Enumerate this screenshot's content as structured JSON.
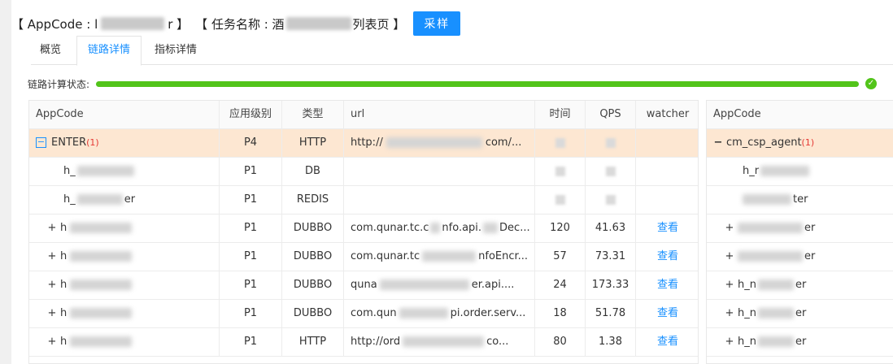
{
  "header": {
    "appcode_prefix": "【 AppCode : l",
    "appcode_suffix": "r 】",
    "task_prefix": "【 任务名称 : 酒",
    "task_suffix": "列表页 】",
    "sample_button": "采样"
  },
  "tabs": [
    {
      "label": "概览",
      "active": false
    },
    {
      "label": "链路详情",
      "active": true
    },
    {
      "label": "指标详情",
      "active": false
    }
  ],
  "status": {
    "label": "链路计算状态:",
    "progress": 1.0,
    "color": "#52c41a"
  },
  "main_table": {
    "headers": [
      "AppCode",
      "应用级别",
      "类型",
      "url",
      "时间",
      "QPS",
      "watcher"
    ],
    "rows": [
      {
        "toggle": "−",
        "app": "ENTER",
        "count": "(1)",
        "level": "P4",
        "type": "HTTP",
        "url": "http://",
        "url_tail": "com/...",
        "time": "",
        "qps": "",
        "watcher": ""
      },
      {
        "toggle": "",
        "app": "h_",
        "count": "",
        "level": "P1",
        "type": "DB",
        "url": "",
        "url_tail": "",
        "time": "",
        "qps": "",
        "watcher": ""
      },
      {
        "toggle": "",
        "app": "h_",
        "app_tail": "er",
        "count": "",
        "level": "P1",
        "type": "REDIS",
        "url": "",
        "url_tail": "",
        "time": "",
        "qps": "",
        "watcher": ""
      },
      {
        "toggle": "+",
        "app": "h",
        "count": "",
        "level": "P1",
        "type": "DUBBO",
        "url": "com.qunar.tc.c",
        "url_tail": "nfo.api.",
        "url_end": "Dec...",
        "time": "120",
        "qps": "41.63",
        "watcher": "查看"
      },
      {
        "toggle": "+",
        "app": "h",
        "count": "",
        "level": "P1",
        "type": "DUBBO",
        "url": "com.qunar.tc",
        "url_tail": "nfoEncr...",
        "time": "57",
        "qps": "73.31",
        "watcher": "查看"
      },
      {
        "toggle": "+",
        "app": "h",
        "count": "",
        "level": "P1",
        "type": "DUBBO",
        "url": "quna",
        "url_tail": "er.api....",
        "time": "24",
        "qps": "173.33",
        "watcher": "查看"
      },
      {
        "toggle": "+",
        "app": "h",
        "count": "",
        "level": "P1",
        "type": "DUBBO",
        "url": "com.qun",
        "url_tail": "pi.order.serv...",
        "time": "18",
        "qps": "51.78",
        "watcher": "查看"
      },
      {
        "toggle": "+",
        "app": "h",
        "count": "",
        "level": "P1",
        "type": "HTTP",
        "url": "http://ord",
        "url_tail": "co...",
        "time": "80",
        "qps": "1.38",
        "watcher": "查看"
      }
    ]
  },
  "side_table": {
    "header": "AppCode",
    "rows": [
      {
        "toggle": "−",
        "app": "cm_csp_agent",
        "count": "(1)"
      },
      {
        "toggle": "",
        "app": "h_r",
        "tail": ""
      },
      {
        "toggle": "",
        "app": "",
        "tail": "ter"
      },
      {
        "toggle": "+",
        "app": "",
        "tail": "er"
      },
      {
        "toggle": "+",
        "app": "",
        "tail": "er"
      },
      {
        "toggle": "+",
        "app": "h_n",
        "tail": "er"
      },
      {
        "toggle": "+",
        "app": "h_n",
        "tail": "er"
      },
      {
        "toggle": "+",
        "app": "h_n",
        "tail": "er"
      }
    ]
  },
  "icons": {
    "check": "check-circle-icon",
    "collapse": "minus-square-icon",
    "expand": "plus-icon"
  }
}
